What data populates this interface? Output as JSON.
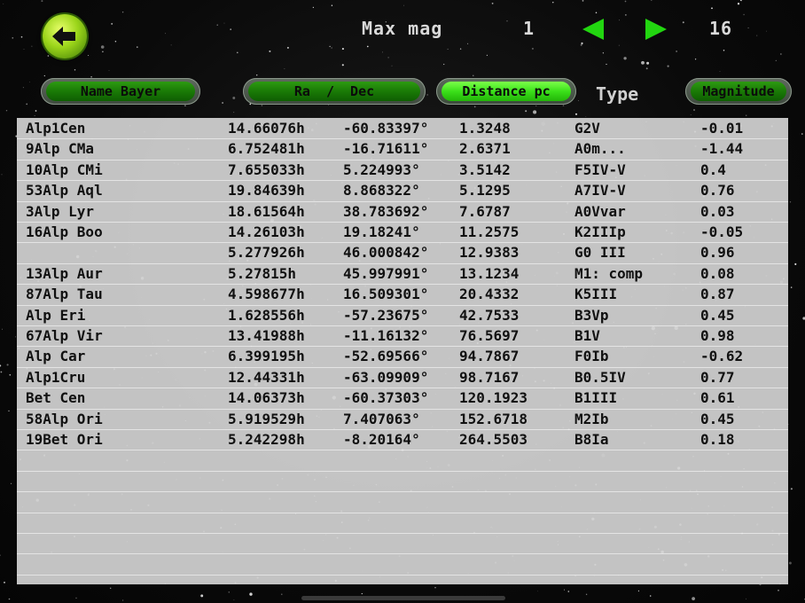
{
  "header": {
    "max_mag_label": "Max mag",
    "min_value": "1",
    "max_value": "16",
    "back_icon": "back-arrow-icon",
    "prev_icon": "triangle-left-icon",
    "next_icon": "triangle-right-icon",
    "accent_color": "#3be01a"
  },
  "columns": {
    "name": "Name Bayer",
    "radec": "Ra  /  Dec",
    "distance": "Distance pc",
    "type": "Type",
    "magnitude": "Magnitude",
    "active": "distance"
  },
  "rows": [
    {
      "name": "Alp1Cen",
      "ra": "14.66076h",
      "dec": "-60.83397°",
      "dist": "1.3248",
      "type": "G2V",
      "mag": "-0.01"
    },
    {
      "name": "9Alp CMa",
      "ra": "6.752481h",
      "dec": "-16.71611°",
      "dist": "2.6371",
      "type": "A0m...",
      "mag": "-1.44"
    },
    {
      "name": "10Alp CMi",
      "ra": "7.655033h",
      "dec": "5.224993°",
      "dist": "3.5142",
      "type": "F5IV-V",
      "mag": "0.4"
    },
    {
      "name": "53Alp Aql",
      "ra": "19.84639h",
      "dec": "8.868322°",
      "dist": "5.1295",
      "type": "A7IV-V",
      "mag": "0.76"
    },
    {
      "name": "3Alp Lyr",
      "ra": "18.61564h",
      "dec": "38.783692°",
      "dist": "7.6787",
      "type": "A0Vvar",
      "mag": "0.03"
    },
    {
      "name": "16Alp Boo",
      "ra": "14.26103h",
      "dec": "19.18241°",
      "dist": "11.2575",
      "type": "K2IIIp",
      "mag": "-0.05"
    },
    {
      "name": "",
      "ra": "5.277926h",
      "dec": "46.000842°",
      "dist": "12.9383",
      "type": "G0 III",
      "mag": "0.96"
    },
    {
      "name": "13Alp Aur",
      "ra": "5.27815h",
      "dec": "45.997991°",
      "dist": "13.1234",
      "type": "M1: comp",
      "mag": "0.08"
    },
    {
      "name": "87Alp Tau",
      "ra": "4.598677h",
      "dec": "16.509301°",
      "dist": "20.4332",
      "type": "K5III",
      "mag": "0.87"
    },
    {
      "name": "Alp Eri",
      "ra": "1.628556h",
      "dec": "-57.23675°",
      "dist": "42.7533",
      "type": "B3Vp",
      "mag": "0.45"
    },
    {
      "name": "67Alp Vir",
      "ra": "13.41988h",
      "dec": "-11.16132°",
      "dist": "76.5697",
      "type": "B1V",
      "mag": "0.98"
    },
    {
      "name": "Alp Car",
      "ra": "6.399195h",
      "dec": "-52.69566°",
      "dist": "94.7867",
      "type": "F0Ib",
      "mag": "-0.62"
    },
    {
      "name": "Alp1Cru",
      "ra": "12.44331h",
      "dec": "-63.09909°",
      "dist": "98.7167",
      "type": "B0.5IV",
      "mag": "0.77"
    },
    {
      "name": "Bet Cen",
      "ra": "14.06373h",
      "dec": "-60.37303°",
      "dist": "120.1923",
      "type": "B1III",
      "mag": "0.61"
    },
    {
      "name": "58Alp Ori",
      "ra": "5.919529h",
      "dec": "7.407063°",
      "dist": "152.6718",
      "type": "M2Ib",
      "mag": "0.45"
    },
    {
      "name": "19Bet Ori",
      "ra": "5.242298h",
      "dec": "-8.20164°",
      "dist": "264.5503",
      "type": "B8Ia",
      "mag": "0.18"
    }
  ]
}
